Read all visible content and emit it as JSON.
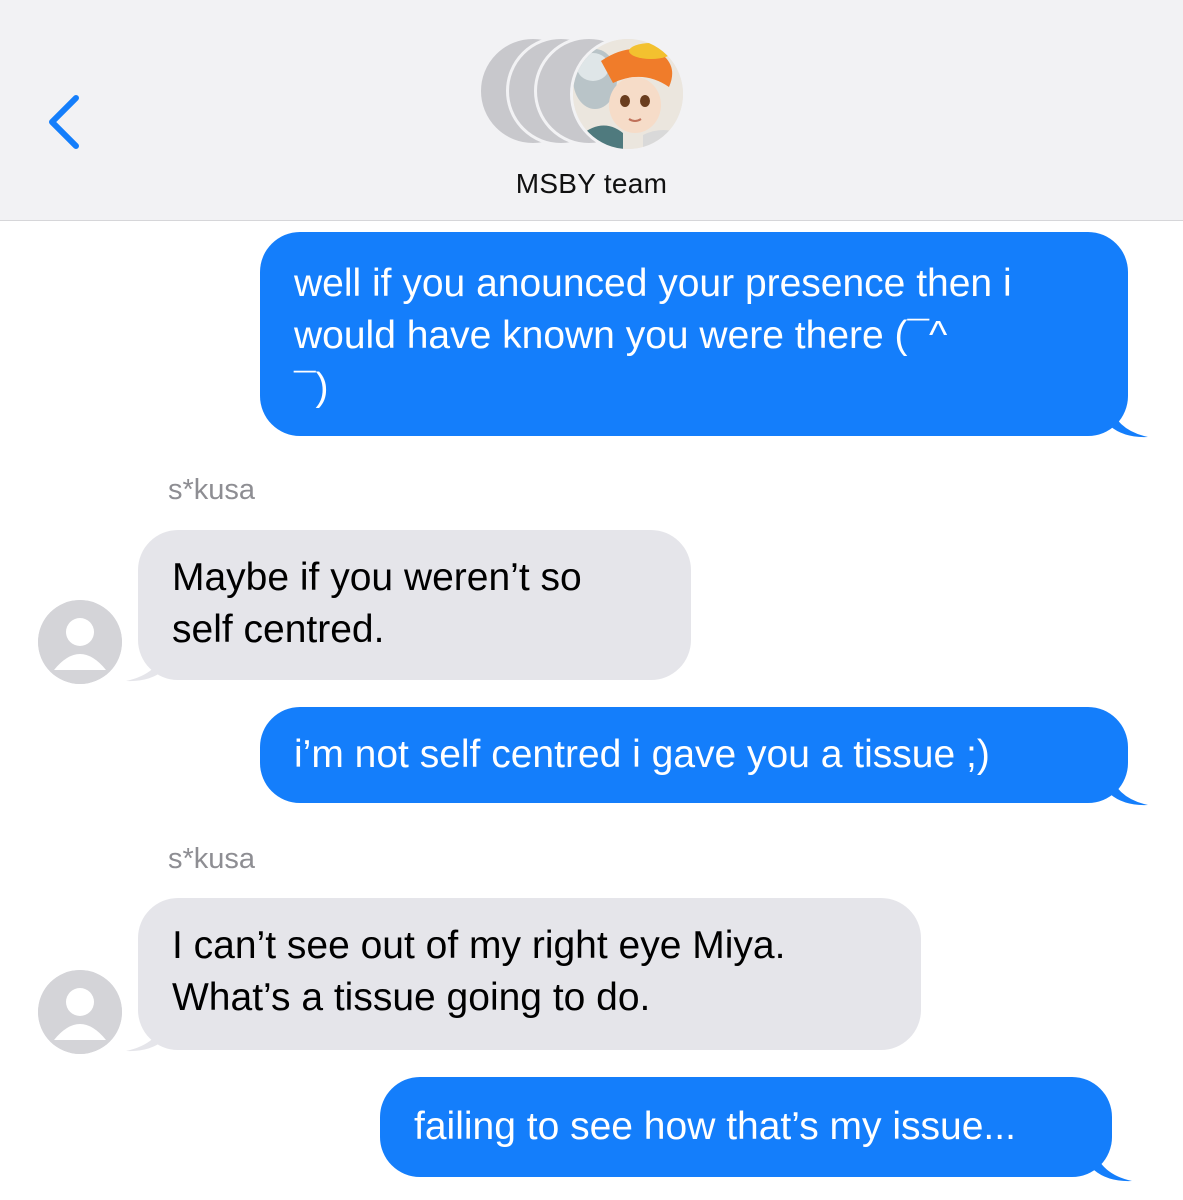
{
  "header": {
    "title": "MSBY team",
    "back_icon": "chevron-left-icon",
    "accent_color": "#147efb"
  },
  "messages": [
    {
      "direction": "outgoing",
      "text": "well if you anounced your presence then i would have known you were there (¯^\n¯)"
    },
    {
      "direction": "incoming",
      "sender": "s*kusa",
      "text": "Maybe if you weren’t so self centred."
    },
    {
      "direction": "outgoing",
      "text": "i’m not self centred i gave you a tissue ;)"
    },
    {
      "direction": "incoming",
      "sender": "s*kusa",
      "text": "I can’t see out of my right eye Miya. What’s a tissue going to do."
    },
    {
      "direction": "outgoing",
      "text": "failing to see how that’s my issue..."
    }
  ],
  "colors": {
    "outgoing_bubble": "#147efb",
    "incoming_bubble": "#e5e5ea",
    "header_bg": "#f2f2f4"
  }
}
